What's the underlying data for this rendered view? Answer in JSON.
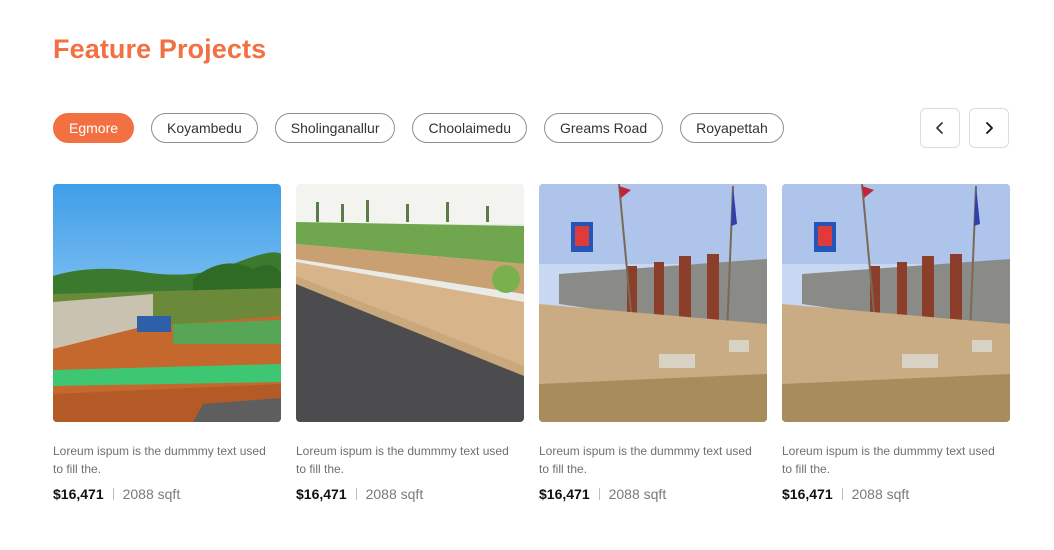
{
  "section": {
    "title": "Feature Projects"
  },
  "filters": [
    {
      "label": "Egmore",
      "active": true
    },
    {
      "label": "Koyambedu",
      "active": false
    },
    {
      "label": "Sholinganallur",
      "active": false
    },
    {
      "label": "Choolaimedu",
      "active": false
    },
    {
      "label": "Greams Road",
      "active": false
    },
    {
      "label": "Royapettah",
      "active": false
    }
  ],
  "nav": {
    "prev_icon": "chevron-left-icon",
    "next_icon": "chevron-right-icon"
  },
  "colors": {
    "accent": "#f27042"
  },
  "cards": [
    {
      "image": "green-plot-photo",
      "description": "Loreum ispum is the dummmy text used to fill the.",
      "price": "$16,471",
      "area": "2088 sqft"
    },
    {
      "image": "road-plot-photo",
      "description": "Loreum ispum is the dummmy text used to fill the.",
      "price": "$16,471",
      "area": "2088 sqft"
    },
    {
      "image": "wall-plot-photo",
      "description": "Loreum ispum is the dummmy text used to fill the.",
      "price": "$16,471",
      "area": "2088 sqft"
    },
    {
      "image": "wall-plot-photo",
      "description": "Loreum ispum is the dummmy text used to fill the.",
      "price": "$16,471",
      "area": "2088 sqft"
    }
  ]
}
